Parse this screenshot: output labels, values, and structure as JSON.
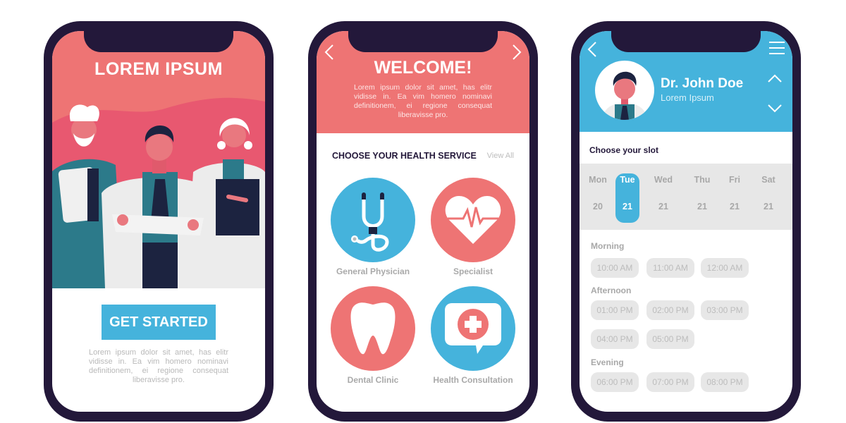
{
  "colors": {
    "phone_frame": "#23183a",
    "coral": "#ee7474",
    "blue": "#45b3dc",
    "muted_text": "#b9b9b9",
    "slot_bg": "#e7e7e7"
  },
  "phone1": {
    "title": "LOREM IPSUM",
    "illustration": "three-doctors-illustration",
    "cta_label": "GET STARTED",
    "body_text": "Lorem ipsum dolor sit amet, has elitr vidisse in. Ea vim homero nominavi definitionem, ei regione consequat liberavisse pro."
  },
  "phone2": {
    "nav_prev_icon": "chevron-left-icon",
    "nav_next_icon": "chevron-right-icon",
    "title": "WELCOME!",
    "body_text": "Lorem ipsum dolor sit amet, has elitr vidisse in. Ea vim homero nominavi definitionem, ei regione consequat liberavisse pro.",
    "section_title": "CHOOSE YOUR HEALTH SERVICE",
    "view_all": "View All",
    "services": [
      {
        "label": "General Physician",
        "icon": "stethoscope-icon",
        "color": "#45b3dc"
      },
      {
        "label": "Specialist",
        "icon": "heartbeat-icon",
        "color": "#ee7474"
      },
      {
        "label": "Dental Clinic",
        "icon": "tooth-icon",
        "color": "#ee7474"
      },
      {
        "label": "Health Consultation",
        "icon": "medical-chat-icon",
        "color": "#45b3dc"
      }
    ]
  },
  "phone3": {
    "back_icon": "chevron-left-icon",
    "menu_icon": "hamburger-menu-icon",
    "doctor_name": "Dr. John Doe",
    "doctor_subtitle": "Lorem Ipsum",
    "slot_title": "Choose your slot",
    "days": [
      {
        "name": "Mon",
        "num": "20",
        "selected": false
      },
      {
        "name": "Tue",
        "num": "21",
        "selected": true
      },
      {
        "name": "Wed",
        "num": "21",
        "selected": false
      },
      {
        "name": "Thu",
        "num": "21",
        "selected": false
      },
      {
        "name": "Fri",
        "num": "21",
        "selected": false
      },
      {
        "name": "Sat",
        "num": "21",
        "selected": false
      }
    ],
    "periods": [
      {
        "label": "Morning",
        "slots": [
          "10:00 AM",
          "11:00 AM",
          "12:00 AM"
        ]
      },
      {
        "label": "Afternoon",
        "slots": [
          "01:00 PM",
          "02:00 PM",
          "03:00 PM",
          "04:00 PM",
          "05:00 PM"
        ]
      },
      {
        "label": "Evening",
        "slots": [
          "06:00 PM",
          "07:00 PM",
          "08:00 PM"
        ]
      }
    ]
  }
}
